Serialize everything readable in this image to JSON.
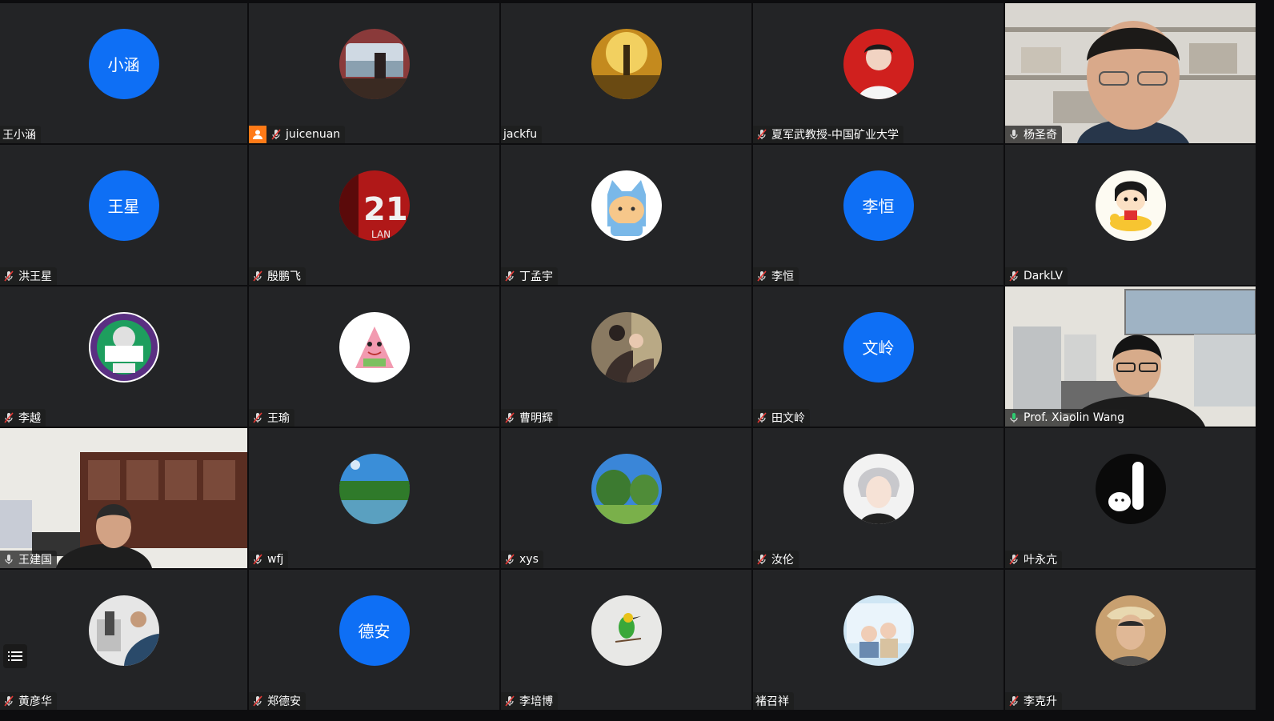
{
  "colors": {
    "tile_bg": "#232426",
    "initials_bg": "#0e6ff5",
    "active_border": "#2ecc71",
    "host_badge": "#ff7a17"
  },
  "list_button": {
    "icon": "list-icon"
  },
  "participants": [
    {
      "name": "王小涵",
      "avatar": "initials",
      "initials": "小涵",
      "mic": "none"
    },
    {
      "name": "juicenuan",
      "avatar": "photo",
      "mic": "muted",
      "host": true
    },
    {
      "name": "jackfu",
      "avatar": "photo",
      "mic": "none"
    },
    {
      "name": "夏军武教授-中国矿业大学",
      "avatar": "photo",
      "mic": "muted"
    },
    {
      "name": "杨圣奇",
      "avatar": "video",
      "mic": "on"
    },
    {
      "name": "洪王星",
      "avatar": "initials",
      "initials": "王星",
      "mic": "muted"
    },
    {
      "name": "殷鹏飞",
      "avatar": "photo",
      "mic": "muted"
    },
    {
      "name": "丁孟宇",
      "avatar": "photo",
      "mic": "muted"
    },
    {
      "name": "李恒",
      "avatar": "initials",
      "initials": "李恒",
      "mic": "muted"
    },
    {
      "name": "DarkLV",
      "avatar": "photo",
      "mic": "muted"
    },
    {
      "name": "李越",
      "avatar": "photo",
      "mic": "muted"
    },
    {
      "name": "王瑜",
      "avatar": "photo",
      "mic": "muted"
    },
    {
      "name": "曹明辉",
      "avatar": "photo",
      "mic": "muted"
    },
    {
      "name": "田文岭",
      "avatar": "initials",
      "initials": "文岭",
      "mic": "muted"
    },
    {
      "name": "Prof. Xiaolin Wang",
      "avatar": "video",
      "mic": "active",
      "active": true
    },
    {
      "name": "王建国",
      "avatar": "video",
      "mic": "on"
    },
    {
      "name": "wfj",
      "avatar": "photo",
      "mic": "muted"
    },
    {
      "name": "xys",
      "avatar": "photo",
      "mic": "muted"
    },
    {
      "name": "汝伦",
      "avatar": "photo",
      "mic": "muted"
    },
    {
      "name": "叶永亢",
      "avatar": "photo",
      "mic": "muted"
    },
    {
      "name": "黄彦华",
      "avatar": "photo",
      "mic": "muted"
    },
    {
      "name": "郑德安",
      "avatar": "initials",
      "initials": "德安",
      "mic": "muted"
    },
    {
      "name": "李培博",
      "avatar": "photo",
      "mic": "muted"
    },
    {
      "name": "褚召祥",
      "avatar": "photo",
      "mic": "none"
    },
    {
      "name": "李克升",
      "avatar": "photo",
      "mic": "muted"
    }
  ]
}
